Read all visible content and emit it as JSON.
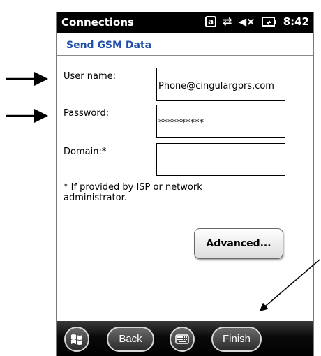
{
  "titlebar": {
    "title": "Connections",
    "time": "8:42"
  },
  "status_icons": [
    "a-icon",
    "connectivity-icon",
    "volume-muted-icon",
    "battery-charging-icon"
  ],
  "heading": "Send GSM Data",
  "form": {
    "username_label": "User name:",
    "username_value": "Phone@cingulargprs.com",
    "password_label": "Password:",
    "password_value": "**********",
    "domain_label": "Domain:*",
    "domain_value": ""
  },
  "note": "* If provided by ISP or network administrator.",
  "advanced_label": "Advanced...",
  "bottombar": {
    "back_label": "Back",
    "finish_label": "Finish"
  },
  "colors": {
    "heading": "#1f4fa8",
    "titlebar_bg": "#000000"
  }
}
